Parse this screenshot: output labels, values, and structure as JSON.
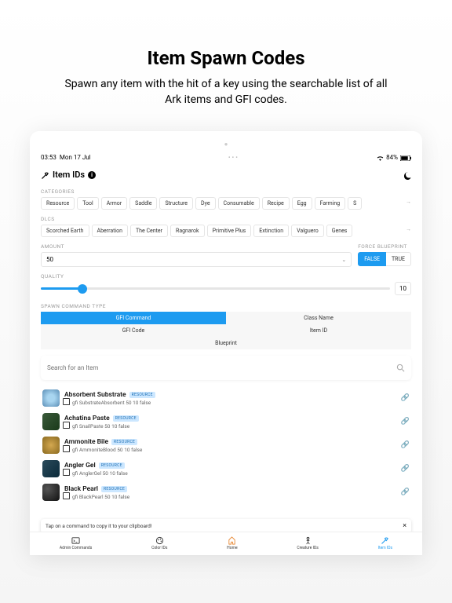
{
  "hero": {
    "title": "Item Spawn Codes",
    "subtitle": "Spawn any item with the hit of a key using the searchable list of all Ark items and GFI codes."
  },
  "status": {
    "time": "03:53",
    "date": "Mon 17 Jul",
    "battery_pct": "84%"
  },
  "header": {
    "title": "Item IDs"
  },
  "categories": {
    "label": "CATEGORIES",
    "items": [
      "Resource",
      "Tool",
      "Armor",
      "Saddle",
      "Structure",
      "Dye",
      "Consumable",
      "Recipe",
      "Egg",
      "Farming",
      "S"
    ]
  },
  "dlcs": {
    "label": "DLCS",
    "items": [
      "Scorched Earth",
      "Aberration",
      "The Center",
      "Ragnarok",
      "Primitive Plus",
      "Extinction",
      "Valguero",
      "Genes"
    ]
  },
  "amount": {
    "label": "AMOUNT",
    "value": "50"
  },
  "force_blueprint": {
    "label": "FORCE BLUEPRINT",
    "false": "FALSE",
    "true": "TRUE"
  },
  "quality": {
    "label": "QUALITY",
    "value": "10"
  },
  "cmd_type": {
    "label": "SPAWN COMMAND TYPE",
    "gfi_command": "GFI Command",
    "class_name": "Class Name",
    "gfi_code": "GFI Code",
    "item_id": "Item ID",
    "blueprint": "Blueprint"
  },
  "search": {
    "placeholder": "Search for an Item"
  },
  "badge_text": "RESOURCE",
  "items": [
    {
      "name": "Absorbent Substrate",
      "cmd": "gfi SubstrateAbsorbent 50 10 false"
    },
    {
      "name": "Achatina Paste",
      "cmd": "gfi SnailPaste 50 10 false"
    },
    {
      "name": "Ammonite Bile",
      "cmd": "gfi AmmoniteBlood 50 10 false"
    },
    {
      "name": "Angler Gel",
      "cmd": "gfi AnglerGel 50 10 false"
    },
    {
      "name": "Black Pearl",
      "cmd": "gfi BlackPearl 50 10 false"
    }
  ],
  "toast": {
    "text": "Tap on a command to copy it to your clipboard!"
  },
  "tabs": {
    "admin": "Admin Commands",
    "color": "Color IDs",
    "home": "Home",
    "creature": "Creature IDs",
    "item": "Item IDs"
  }
}
